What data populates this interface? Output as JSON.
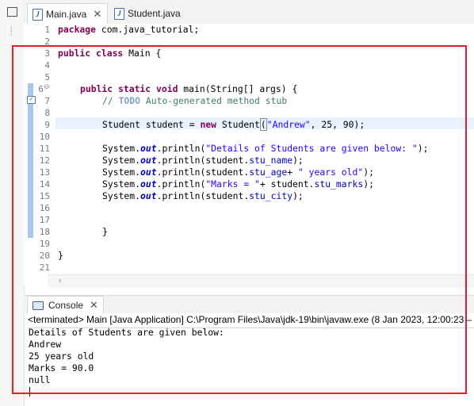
{
  "colors": {
    "highlight": "#e11d28",
    "keyword": "#7f0055",
    "string": "#2a00ff",
    "comment": "#3f7f5f",
    "field": "#0000c0"
  },
  "tabs": [
    {
      "label": "Main.java",
      "icon": "java-file-icon",
      "active": true
    },
    {
      "label": "Student.java",
      "icon": "java-file-icon",
      "active": false
    }
  ],
  "editor": {
    "line_numbers": [
      "1",
      "2",
      "3",
      "4",
      "5",
      "6",
      "7",
      "8",
      "9",
      "10",
      "11",
      "12",
      "13",
      "14",
      "15",
      "16",
      "17",
      "18",
      "19",
      "20",
      "21"
    ],
    "lines": {
      "l1_kw": "package",
      "l1_rest": " com.java_tutorial;",
      "l3_kw": "public class",
      "l3_rest": " Main {",
      "l6_kw": "public static void",
      "l6_rest": " main(String[] args) {",
      "l7_c1": "// ",
      "l7_todo": "TODO",
      "l7_c2": " Auto-generated method stub",
      "l9_a": "Student student = ",
      "l9_kw": "new",
      "l9_b": " Student",
      "l9_paren": "(",
      "l9_str": "\"Andrew\"",
      "l9_c": ", 25, 90);",
      "l11_a": "System.",
      "l11_out": "out",
      "l11_b": ".println(",
      "l11_str": "\"Details of Students are given below: \"",
      "l11_c": ");",
      "l12_a": "System.",
      "l12_out": "out",
      "l12_b": ".println(student.",
      "l12_fld": "stu_name",
      "l12_c": ");",
      "l13_a": "System.",
      "l13_out": "out",
      "l13_b": ".println(student.",
      "l13_fld": "stu_age",
      "l13_c": "+ ",
      "l13_str": "\" years old\"",
      "l13_d": ");",
      "l14_a": "System.",
      "l14_out": "out",
      "l14_b": ".println(",
      "l14_str": "\"Marks = \"",
      "l14_c": "+ student.",
      "l14_fld": "stu_marks",
      "l14_d": ");",
      "l15_a": "System.",
      "l15_out": "out",
      "l15_b": ".println(student.",
      "l15_fld": "stu_city",
      "l15_c": ");",
      "l18": "}",
      "l20": "}"
    }
  },
  "console": {
    "tab_label": "Console",
    "status": "<terminated> Main [Java Application] C:\\Program Files\\Java\\jdk-19\\bin\\javaw.exe  (8 Jan 2023, 12:00:23 –",
    "output": [
      "Details of Students are given below:",
      "Andrew",
      "25 years old",
      "Marks = 90.0",
      "null"
    ]
  }
}
